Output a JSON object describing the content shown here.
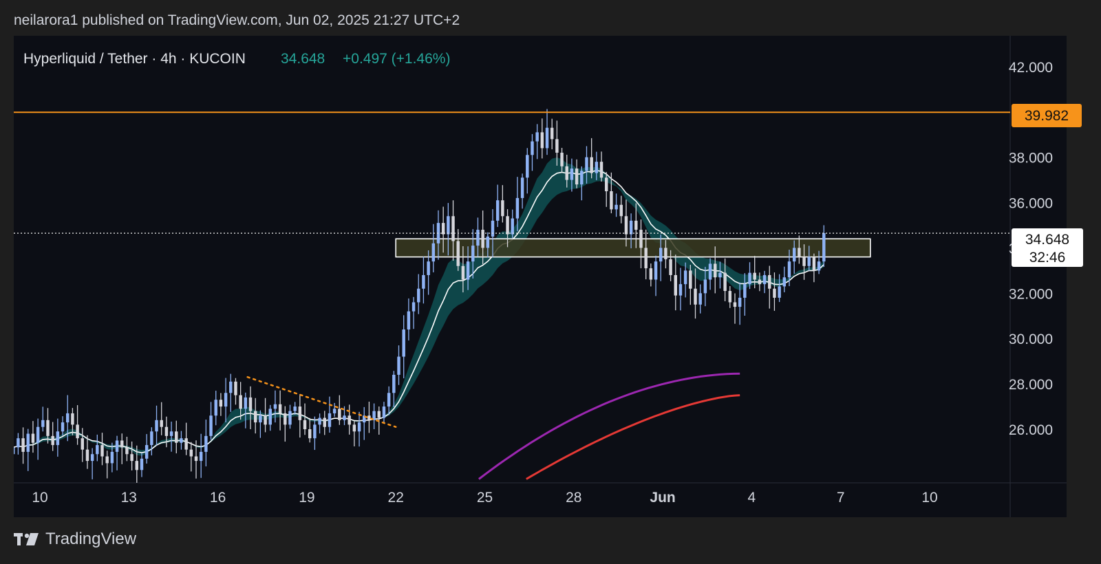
{
  "header": {
    "published": "neilarora1 published on TradingView.com, Jun 02, 2025 21:27 UTC+2"
  },
  "legend": {
    "symbol": "Hyperliquid / Tether · 4h · KUCOIN",
    "price": "34.648",
    "change": "+0.497 (+1.46%)"
  },
  "price_label": {
    "value": "34.648",
    "countdown": "32:46"
  },
  "resistance_label": "39.982",
  "footer": {
    "brand": "TradingView",
    "icon": "tradingview-logo-icon"
  },
  "colors": {
    "up": "#8fb3f5",
    "down": "#d6d6dc",
    "resistance": "#f7931a",
    "ema_band": "#0e4d4f",
    "ema_line": "#ffffff",
    "ma_purple": "#9c27b0",
    "ma_red": "#e53935",
    "zone_fill": "#3a3a20",
    "legend_green": "#26a69a"
  },
  "chart_data": {
    "type": "candlestick",
    "timeframe": "4h",
    "ylim": [
      24.0,
      43.0
    ],
    "yticks": [
      "26.000",
      "28.000",
      "30.000",
      "32.000",
      "34.000",
      "36.000",
      "38.000",
      "42.000"
    ],
    "xticks": [
      "10",
      "13",
      "16",
      "19",
      "22",
      "25",
      "28",
      "Jun",
      "4",
      "7",
      "10"
    ],
    "xtick_days": [
      0,
      3,
      6,
      9,
      12,
      15,
      18,
      21,
      24,
      27,
      30
    ],
    "resistance_level": 39.982,
    "current_price": 34.648,
    "supply_zone": {
      "x_start_day": 12.0,
      "x_end_day": 28.0,
      "y_low": 33.6,
      "y_high": 34.4
    },
    "trendline": {
      "points": [
        [
          7.0,
          28.3
        ],
        [
          12.0,
          26.1
        ]
      ]
    },
    "closes": [
      25.2,
      25.6,
      25.0,
      25.8,
      25.4,
      26.1,
      26.4,
      25.7,
      25.3,
      25.9,
      26.3,
      26.7,
      26.2,
      25.6,
      25.1,
      24.6,
      24.9,
      25.3,
      24.8,
      24.5,
      25.0,
      25.5,
      25.2,
      24.9,
      24.6,
      24.2,
      24.7,
      25.3,
      25.9,
      26.4,
      26.1,
      25.7,
      25.9,
      25.4,
      25.6,
      25.1,
      24.8,
      24.6,
      25.0,
      25.7,
      26.6,
      27.3,
      27.0,
      27.6,
      28.1,
      27.5,
      26.9,
      27.4,
      26.8,
      26.3,
      26.6,
      26.2,
      26.9,
      27.1,
      26.7,
      26.2,
      26.8,
      27.0,
      26.4,
      26.0,
      25.6,
      26.2,
      26.5,
      26.1,
      26.7,
      26.9,
      26.4,
      26.6,
      26.2,
      25.9,
      26.3,
      26.6,
      26.4,
      26.8,
      26.5,
      27.0,
      27.6,
      28.4,
      29.2,
      30.4,
      31.2,
      31.6,
      32.2,
      32.8,
      33.4,
      34.2,
      35.1,
      34.6,
      35.4,
      34.3,
      33.2,
      32.6,
      33.4,
      34.1,
      34.8,
      34.0,
      34.5,
      35.2,
      36.1,
      35.4,
      34.6,
      35.3,
      36.2,
      37.1,
      38.1,
      38.7,
      39.1,
      38.4,
      39.3,
      38.8,
      38.2,
      37.6,
      37.0,
      37.5,
      36.8,
      37.4,
      38.0,
      37.3,
      37.8,
      37.1,
      36.5,
      35.7,
      35.9,
      35.4,
      34.6,
      35.2,
      34.8,
      34.0,
      33.1,
      32.6,
      33.4,
      34.0,
      33.5,
      32.8,
      31.9,
      32.4,
      33.0,
      32.2,
      31.5,
      32.0,
      32.6,
      33.3,
      32.7,
      32.9,
      32.1,
      31.6,
      31.4,
      31.8,
      32.4,
      32.9,
      32.6,
      32.4,
      32.8,
      32.2,
      31.8,
      32.3,
      32.7,
      33.4,
      34.0,
      33.6,
      33.2,
      33.6,
      33.0,
      33.4,
      34.648
    ]
  }
}
